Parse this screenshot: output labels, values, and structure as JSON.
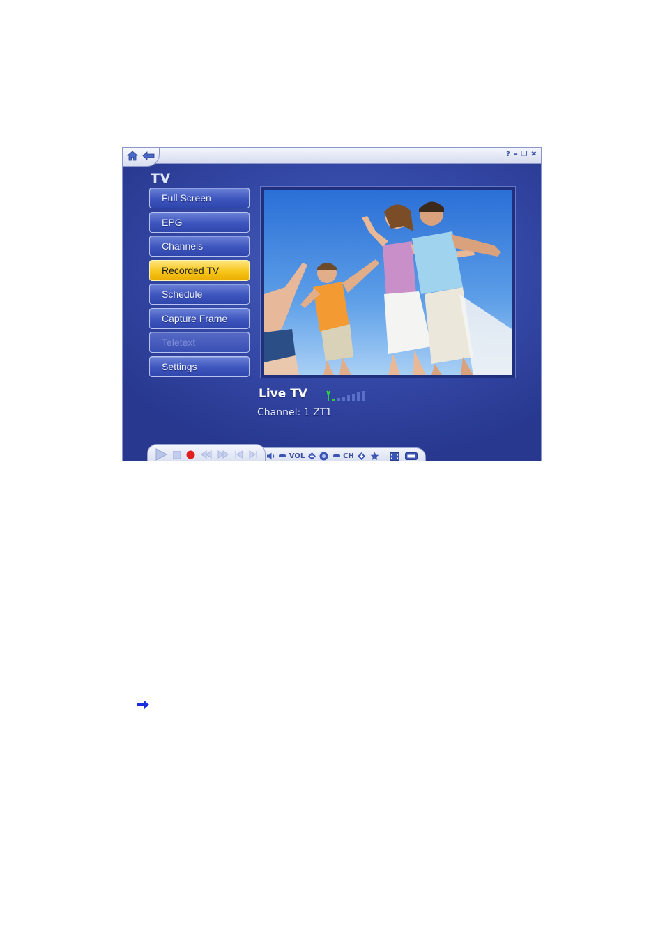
{
  "window": {
    "titlebar_icons": [
      "home-icon",
      "back-icon"
    ],
    "window_controls": [
      {
        "name": "help-icon",
        "glyph": "?"
      },
      {
        "name": "minimize-icon",
        "glyph": "▬"
      },
      {
        "name": "restore-icon",
        "glyph": "❐"
      },
      {
        "name": "close-icon",
        "glyph": "✖"
      }
    ]
  },
  "section": {
    "title": "TV"
  },
  "menu": {
    "items": [
      {
        "label": "Full Screen",
        "state": "normal"
      },
      {
        "label": "EPG",
        "state": "normal"
      },
      {
        "label": "Channels",
        "state": "normal"
      },
      {
        "label": "Recorded TV",
        "state": "active"
      },
      {
        "label": "Schedule",
        "state": "normal"
      },
      {
        "label": "Capture Frame",
        "state": "normal"
      },
      {
        "label": "Teletext",
        "state": "disabled"
      },
      {
        "label": "Settings",
        "state": "normal"
      }
    ]
  },
  "status": {
    "title": "Live TV",
    "channel": "Channel: 1 ZT1",
    "signal_icon": "antenna-icon",
    "signal_level": 0.1
  },
  "controls": {
    "vol_label": "VOL",
    "ch_label": "CH",
    "buttons": [
      "play-icon",
      "stop-icon",
      "record-icon",
      "rewind-icon",
      "fast-forward-icon",
      "skip-back-icon",
      "skip-forward-icon"
    ]
  },
  "colors": {
    "accent_active": "#f7c61a",
    "panel_blue": "#3448a6",
    "record_red": "#e02020",
    "signal_green": "#2fcf3f"
  },
  "page_icon": "arrow-right-icon"
}
